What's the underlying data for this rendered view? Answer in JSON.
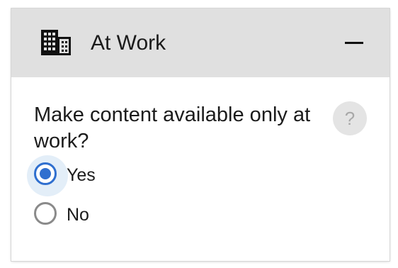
{
  "panel": {
    "title": "At Work",
    "icon": "building-icon",
    "collapse_icon": "minus-icon"
  },
  "question": {
    "text": "Make content available only at work?",
    "help_label": "?"
  },
  "options": [
    {
      "label": "Yes",
      "selected": true
    },
    {
      "label": "No",
      "selected": false
    }
  ],
  "colors": {
    "header_bg": "#e0e0e0",
    "accent": "#2f6fcf",
    "focus_halo": "#e3eef8"
  }
}
